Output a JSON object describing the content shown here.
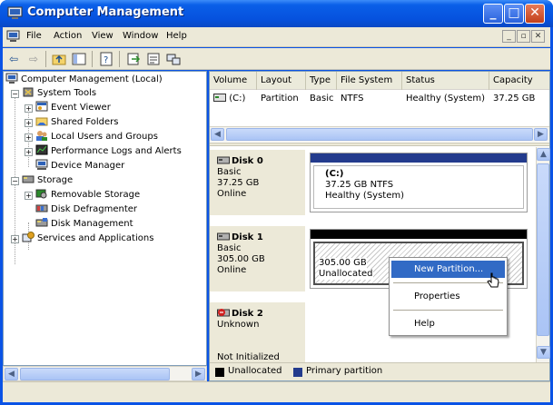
{
  "window": {
    "title": "Computer Management"
  },
  "menu": {
    "items": [
      "File",
      "Action",
      "View",
      "Window",
      "Help"
    ]
  },
  "toolbar": {
    "icons": [
      "back-arrow-icon",
      "forward-arrow-icon",
      "up-folder-icon",
      "show-hide-tree-icon",
      "help-icon",
      "export-list-icon",
      "properties-icon",
      "connect-icon"
    ]
  },
  "tree": {
    "root": "Computer Management (Local)",
    "system_tools": "System Tools",
    "event_viewer": "Event Viewer",
    "shared_folders": "Shared Folders",
    "local_users": "Local Users and Groups",
    "performance": "Performance Logs and Alerts",
    "device_manager": "Device Manager",
    "storage": "Storage",
    "removable": "Removable Storage",
    "defrag": "Disk Defragmenter",
    "disk_management": "Disk Management",
    "services": "Services and Applications"
  },
  "volume_list": {
    "columns": [
      "Volume",
      "Layout",
      "Type",
      "File System",
      "Status",
      "Capacity"
    ],
    "rows": [
      {
        "volume": "(C:)",
        "layout": "Partition",
        "type": "Basic",
        "fs": "NTFS",
        "status": "Healthy (System)",
        "capacity": "37.25 GB"
      }
    ]
  },
  "disks": [
    {
      "name": "Disk 0",
      "type": "Basic",
      "size": "37.25 GB",
      "state": "Online",
      "partition": {
        "label": "(C:)",
        "detail": "37.25 GB NTFS",
        "status": "Healthy (System)"
      }
    },
    {
      "name": "Disk 1",
      "type": "Basic",
      "size": "305.00 GB",
      "state": "Online",
      "partition": {
        "label": "305.00 GB",
        "status": "Unallocated"
      }
    },
    {
      "name": "Disk 2",
      "type": "Unknown",
      "state": "Not Initialized"
    }
  ],
  "legend": {
    "unallocated": "Unallocated",
    "primary": "Primary partition"
  },
  "context_menu": {
    "new_partition": "New Partition...",
    "properties": "Properties",
    "help": "Help"
  },
  "colors": {
    "primary_partition": "#233b8d",
    "unallocated": "#000000",
    "highlight": "#316ac5",
    "title_bar": "#0652de"
  }
}
